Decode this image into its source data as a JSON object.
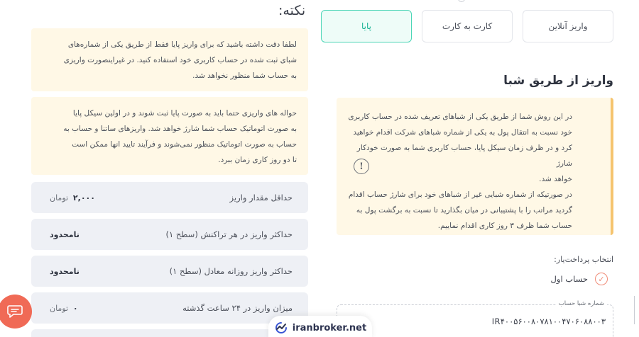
{
  "deposit": {
    "tabs": [
      {
        "label": "واریز آنلاین"
      },
      {
        "label": "کارت به کارت"
      },
      {
        "label": "پایا"
      }
    ],
    "active_tab": "پایا",
    "section_title": "واریز از طریق شبا",
    "warning_lines": [
      "در این روش شما از طریق یکی از شباهای تعریف شده در حساب کاربری",
      "خود نسبت به انتقال پول به یکی از شماره شباهای شرکت اقدام خواهید",
      "کرد و در ظرف زمان سیکل پایا، حساب کاربری شما به صورت خودکار شارژ",
      "خواهد شد.",
      "در صورتیکه از شماره شبایی غیر از شباهای خود برای شارژ حساب اقدام",
      "گردید مراتب را با پشتیبانی در میان بگذارید تا نسبت به برگشت پول به",
      "حساب شما ظرف ۳ روز کاری اقدام نماییم."
    ],
    "warning_icon": "!",
    "payment_select_label": "انتخاب پرداخت‌یار:",
    "account_option": "حساب اول",
    "sheba_caption": "شماره شبا حساب",
    "sheba_value": "IR۴۰۰۵۶۰۰۸۰۷۸۱۰۰۴۷۰۶۰۸۸۰۰۳"
  },
  "notes": {
    "title": "نکته:",
    "note1_lines": [
      "لطفا دقت داشته باشید که برای واریز پایا فقط از طریق یکی از شماره‌های",
      "شبای ثبت شده در حساب کاربری خود استفاده کنید. در غیراینصورت واریزی",
      "به حساب شما منظور نخواهد شد."
    ],
    "note2_lines": [
      "حواله های واریزی حتما باید به صورت پایا ثبت شوند و در اولین سیکل پایا",
      "به صورت اتوماتیک حساب شما شارژ خواهد شد. واریزهای ساتنا و حساب به",
      "حساب به صورت اتوماتیک منظور نمی‌شوند و فرآیند تایید انها ممکن است",
      "تا دو روز کاری زمان ببرد."
    ],
    "limits": [
      {
        "label": "حداقل مقدار واریز",
        "value": "۲,۰۰۰",
        "unit": "تومان"
      },
      {
        "label": "حداکثر واریز در هر تراکنش (سطح ۱)",
        "value": "نامحدود",
        "unit": ""
      },
      {
        "label": "حداکثر واریز روزانه معادل (سطح ۱)",
        "value": "نامحدود",
        "unit": ""
      },
      {
        "label": "میزان واریز در ۲۴ ساعت گذشته",
        "value": "۰",
        "unit": "تومان"
      }
    ]
  },
  "brand": {
    "text": "iranbroker.net"
  },
  "icons": {
    "chat": "chat-bubble-icon",
    "check": "check-circle-icon",
    "warning": "warning-icon"
  },
  "colors": {
    "accent": "#18b294",
    "warning_bg": "#fff8e6",
    "fab": "#f06a56"
  }
}
